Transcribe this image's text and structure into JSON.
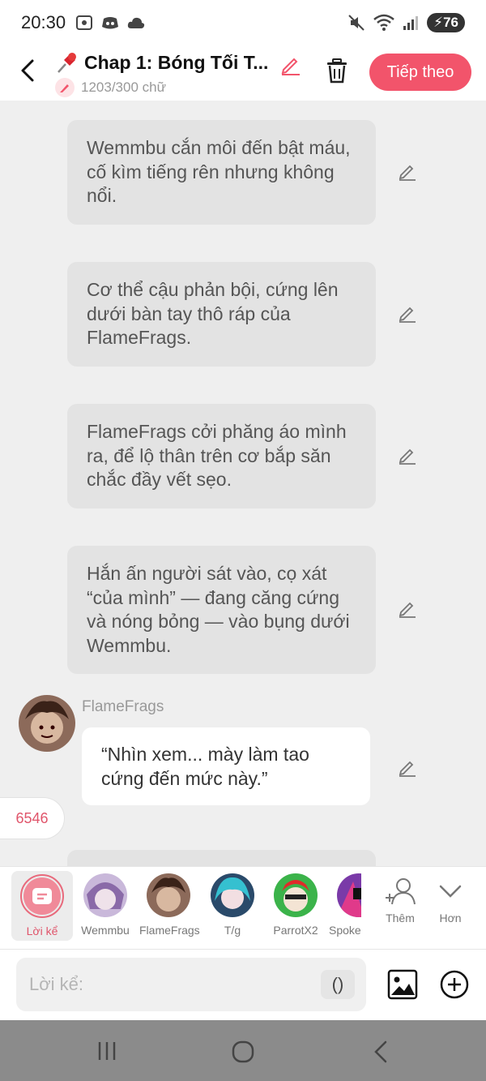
{
  "status_bar": {
    "time": "20:30",
    "battery": "76"
  },
  "header": {
    "title": "Chap 1: Bóng Tối T...",
    "word_count": "1203/300 chữ",
    "next_button": "Tiếp theo"
  },
  "chat": {
    "narrations": [
      "Wemmbu cắn môi đến bật máu, cố kìm tiếng rên nhưng không nổi.",
      "Cơ thể cậu phản bội, cứng lên dưới bàn tay thô ráp của FlameFrags.",
      "FlameFrags cởi phăng áo mình ra, để lộ thân trên cơ bắp săn chắc đầy vết sẹo.",
      "Hắn ấn người sát vào, cọ xát “của mình” — đang căng cứng và nóng bỏng — vào bụng dưới Wemmbu."
    ],
    "message": {
      "speaker": "FlameFrags",
      "text": "“Nhìn xem... mày làm tao cứng đến mức này.”"
    },
    "counter": "6546"
  },
  "characters": [
    {
      "label": "Lời kể",
      "selected": true
    },
    {
      "label": "Wemmbu"
    },
    {
      "label": "FlameFrags"
    },
    {
      "label": "T/g"
    },
    {
      "label": "ParrotX2"
    },
    {
      "label": "Spoke"
    }
  ],
  "more": {
    "add_label": "Thêm",
    "more_label": "Hơn"
  },
  "input": {
    "placeholder": "Lời kể:",
    "paren": "()"
  },
  "colors": {
    "accent": "#f2546b",
    "bubble_gray": "#e3e3e3",
    "background": "#efefef"
  }
}
